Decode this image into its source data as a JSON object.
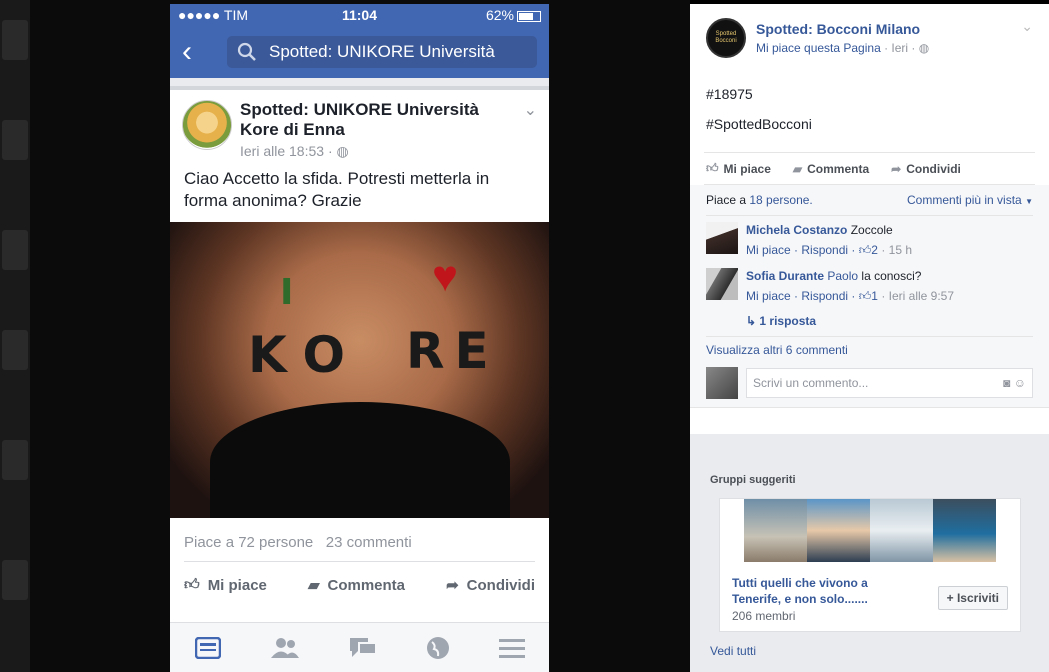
{
  "phone": {
    "status": {
      "carrier": "●●●●● TIM",
      "time": "11:04",
      "battery": "62%"
    },
    "search_text": "Spotted: UNIKORE Università",
    "post": {
      "author": "Spotted: UNIKORE Università Kore di Enna",
      "time": "Ieri alle 18:53 ·",
      "text": "Ciao Accetto la sfida. Potresti metterla in forma anonima? Grazie",
      "image_text": {
        "i": "I",
        "ko": "KO",
        "re": "RE"
      },
      "likes": "Piace a 72 persone",
      "comments": "23 commenti",
      "actions": {
        "like": "Mi piace",
        "comment": "Commenta",
        "share": "Condividi"
      }
    },
    "tabs": [
      "news-feed-icon",
      "friends-icon",
      "messages-icon",
      "globe-icon",
      "menu-icon"
    ]
  },
  "panel": {
    "page_name": "Spotted: Bocconi Milano",
    "page_avatar_text": "Spotted Bocconi",
    "page_like_link": "Mi piace questa Pagina",
    "page_sub_time": "· Ieri ·",
    "post_number": "#18975",
    "hashtag": "#SpottedBocconi",
    "actions": {
      "like": "Mi piace",
      "comment": "Commenta",
      "share": "Condividi"
    },
    "likes_prefix": "Piace a",
    "likes_link": "18 persone.",
    "sort_label": "Commenti più in vista",
    "comments": [
      {
        "author": "Michela Costanzo",
        "tag": "",
        "text": "Zoccole",
        "like": "Mi piace",
        "reply": "Rispondi",
        "count": "2",
        "time": "15 h"
      },
      {
        "author": "Sofia Durante",
        "tag": "Paolo",
        "text": "la conosci?",
        "like": "Mi piace",
        "reply": "Rispondi",
        "count": "1",
        "time": "Ieri alle 9:57"
      }
    ],
    "reply_link": "1 risposta",
    "more_comments": "Visualizza altri 6 commenti",
    "compose_placeholder": "Scrivi un commento...",
    "groups_title": "Gruppi suggeriti",
    "group": {
      "name": "Tutti quelli che vivono a Tenerife, e non solo.......",
      "members": "206 membri",
      "join": "+ Iscriviti"
    },
    "see_all": "Vedi tutti"
  }
}
